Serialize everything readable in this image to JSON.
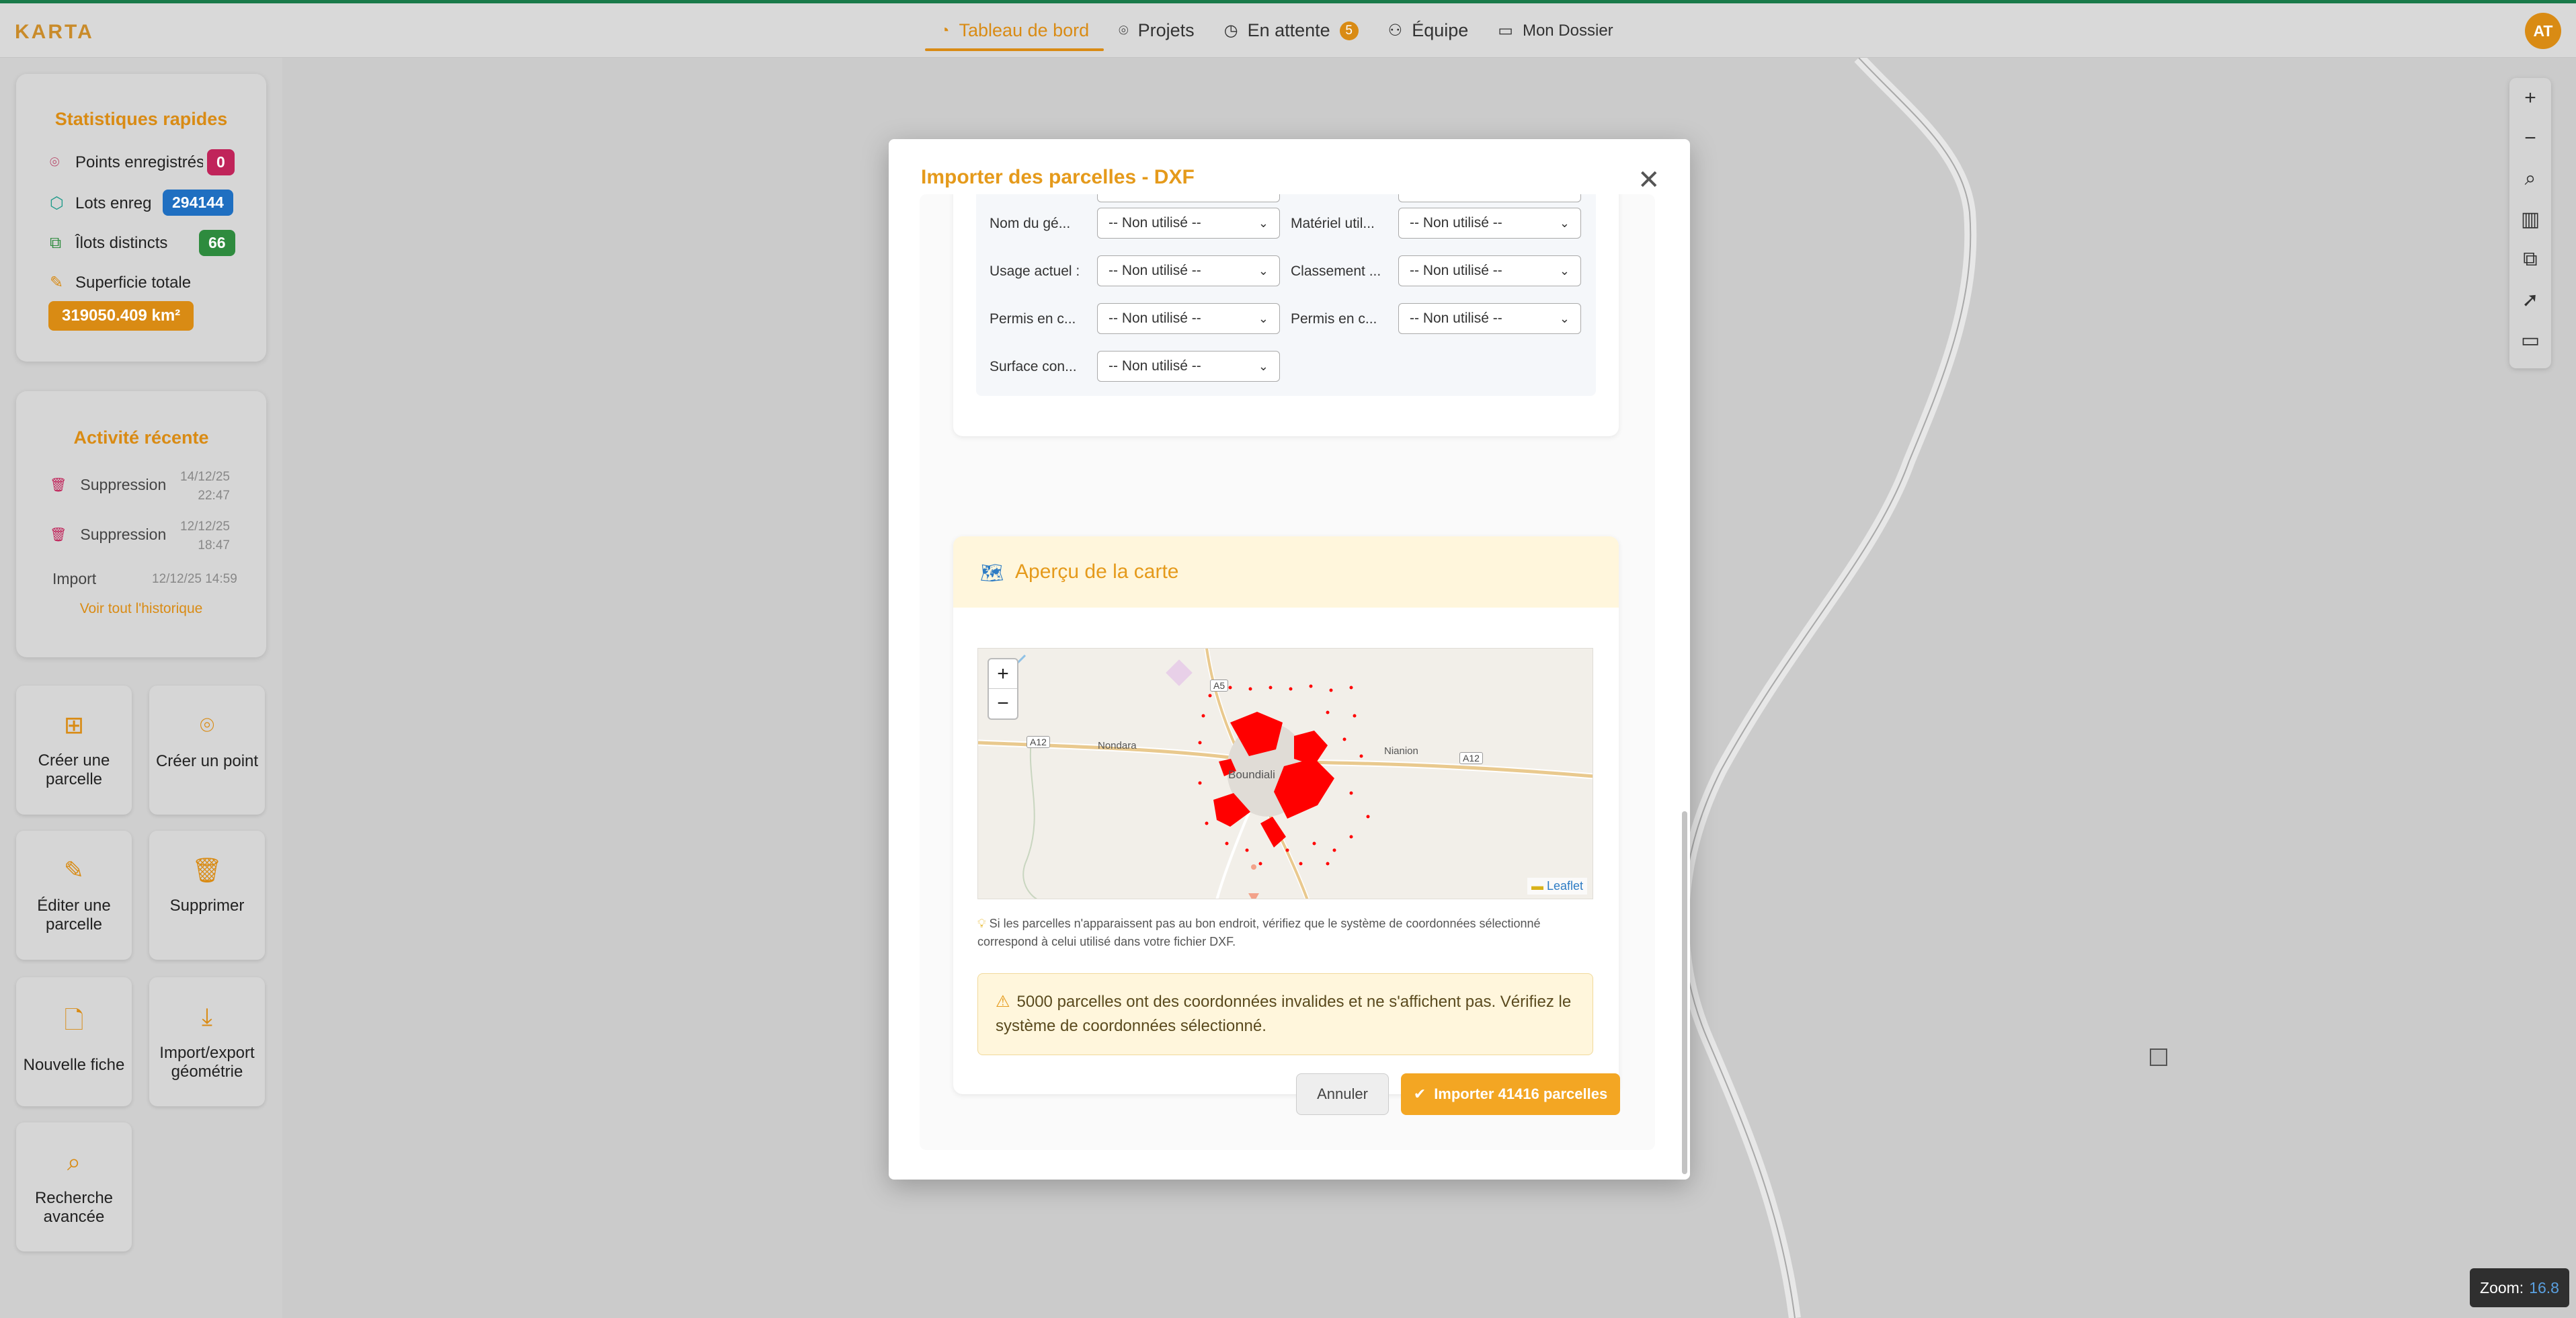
{
  "app": {
    "logo": "KARTA",
    "avatar_initials": "AT"
  },
  "nav": {
    "items": [
      {
        "label": "Tableau de bord",
        "icon": "palette-icon",
        "active": true
      },
      {
        "label": "Projets",
        "icon": "pin-icon"
      },
      {
        "label": "En attente",
        "icon": "clock-icon",
        "badge": "5"
      },
      {
        "label": "Équipe",
        "icon": "users-icon"
      },
      {
        "label": "Mon Dossier",
        "icon": "folder-icon"
      }
    ]
  },
  "stats": {
    "title": "Statistiques rapides",
    "points_label": "Points enregistrés",
    "points_value": "0",
    "lots_label": "Lots enregistrés",
    "lots_value": "294144",
    "ilots_label": "Îlots distincts",
    "ilots_value": "66",
    "surface_label": "Superficie totale",
    "surface_value": "319050.409 km²"
  },
  "activity": {
    "title": "Activité récente",
    "items": [
      {
        "label": "Suppression",
        "date": "14/12/25",
        "time": "22:47"
      },
      {
        "label": "Suppression",
        "date": "12/12/25",
        "time": "18:47"
      },
      {
        "label": "Import",
        "datetime": "12/12/25 14:59"
      }
    ],
    "history_link": "Voir tout l'historique"
  },
  "tiles": [
    {
      "label": "Créer une parcelle",
      "icon": "plus-square-icon"
    },
    {
      "label": "Créer un point",
      "icon": "pin-icon"
    },
    {
      "label": "Éditer une parcelle",
      "icon": "edit-icon"
    },
    {
      "label": "Supprimer",
      "icon": "trash-icon"
    },
    {
      "label": "Nouvelle fiche",
      "icon": "file-plus-icon"
    },
    {
      "label": "Import/export géométrie",
      "icon": "download-icon"
    },
    {
      "label": "Recherche avancée",
      "icon": "search-icon"
    }
  ],
  "modal": {
    "title": "Importer des parcelles - DXF",
    "mapping": [
      {
        "label": "Nom du gé...",
        "value": "-- Non utilisé --"
      },
      {
        "label": "Matériel util...",
        "value": "-- Non utilisé --"
      },
      {
        "label": "Usage actuel :",
        "value": "-- Non utilisé --"
      },
      {
        "label": "Classement ...",
        "value": "-- Non utilisé --"
      },
      {
        "label": "Permis en c...",
        "value": "-- Non utilisé --"
      },
      {
        "label": "Permis en c...",
        "value": "-- Non utilisé --"
      },
      {
        "label": "Surface con...",
        "value": "-- Non utilisé --"
      }
    ],
    "preview_title": "Aperçu de la carte",
    "mini_map": {
      "places": [
        "Nondara",
        "Boundiali",
        "Nianion"
      ],
      "roads": [
        "A12",
        "A12",
        "A5"
      ],
      "attribution": "Leaflet"
    },
    "hint": "Si les parcelles n'apparaissent pas au bon endroit, vérifiez que le système de coordonnées sélectionné correspond à celui utilisé dans votre fichier DXF.",
    "warning": "5000 parcelles ont des coordonnées invalides et ne s'affichent pas. Vérifiez le système de coordonnées sélectionné.",
    "cancel_label": "Annuler",
    "import_label": "Importer 41416 parcelles"
  },
  "map": {
    "zoom_label": "Zoom:",
    "zoom_value": "16.8"
  }
}
